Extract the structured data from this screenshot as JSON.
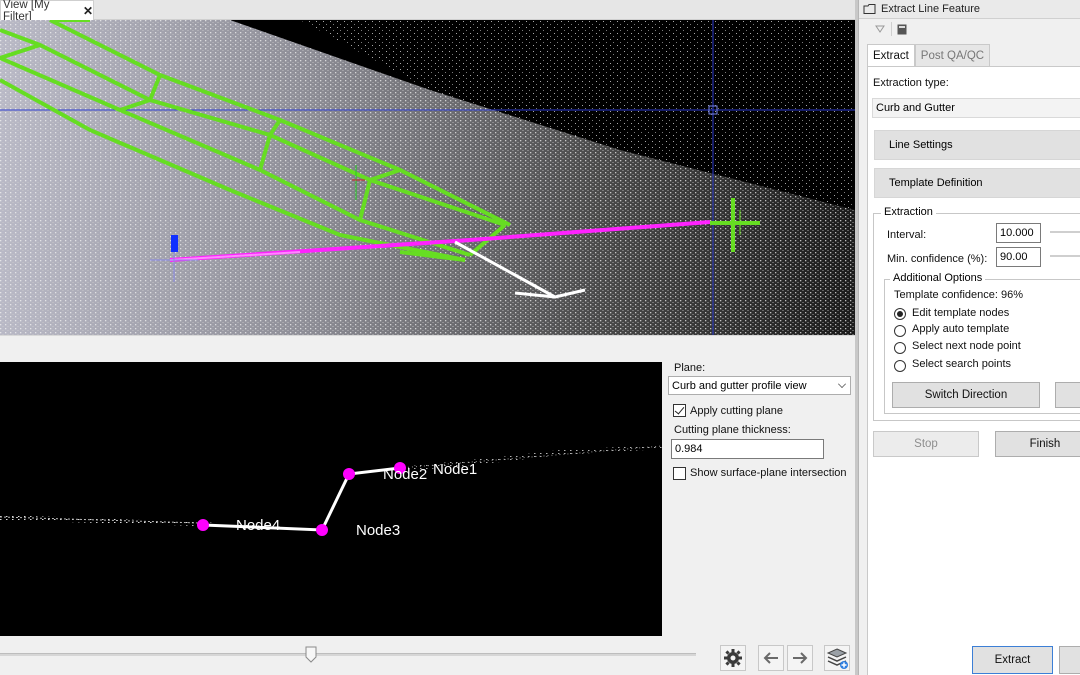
{
  "document_tab": {
    "title": "View [My Filter]",
    "close_glyph": "✕"
  },
  "profile_view": {
    "nodes": [
      "Node1",
      "Node2",
      "Node3",
      "Node4"
    ]
  },
  "plane_panel": {
    "plane_label": "Plane:",
    "plane_value": "Curb and gutter profile view",
    "apply_cutting_plane_label": "Apply cutting plane",
    "apply_cutting_plane_checked": true,
    "thickness_label": "Cutting plane thickness:",
    "thickness_value": "0.984",
    "show_intersection_label": "Show surface-plane intersection",
    "show_intersection_checked": false
  },
  "bottom_toolbar": {
    "icons": [
      "gear-icon",
      "arrow-left-icon",
      "arrow-right-icon",
      "layers-icon"
    ]
  },
  "right_panel": {
    "title": "Extract Line Feature",
    "tabs": [
      {
        "label": "Extract",
        "active": true
      },
      {
        "label": "Post QA/QC",
        "active": false
      }
    ],
    "extraction_type_label": "Extraction type:",
    "extraction_type_value": "Curb and Gutter",
    "line_settings_label": "Line Settings",
    "template_definition_label": "Template Definition",
    "extraction_group": {
      "legend": "Extraction",
      "interval_label": "Interval:",
      "interval_value": "10.000",
      "min_confidence_label": "Min. confidence (%):",
      "min_confidence_value": "90.00"
    },
    "additional_options": {
      "legend": "Additional Options",
      "template_confidence": "Template confidence: 96%",
      "options": [
        {
          "label": "Edit template nodes",
          "selected": true
        },
        {
          "label": "Apply auto template",
          "selected": false
        },
        {
          "label": "Select next node point",
          "selected": false
        },
        {
          "label": "Select search points",
          "selected": false
        }
      ],
      "switch_direction_label": "Switch Direction"
    },
    "stop_label": "Stop",
    "finish_label": "Finish",
    "extract_label": "Extract"
  },
  "colors": {
    "template_green": "#66dd22",
    "profile_magenta": "#ff00ff",
    "axis_blue": "#1030ff",
    "selection_blue": "#3c7fd6"
  }
}
